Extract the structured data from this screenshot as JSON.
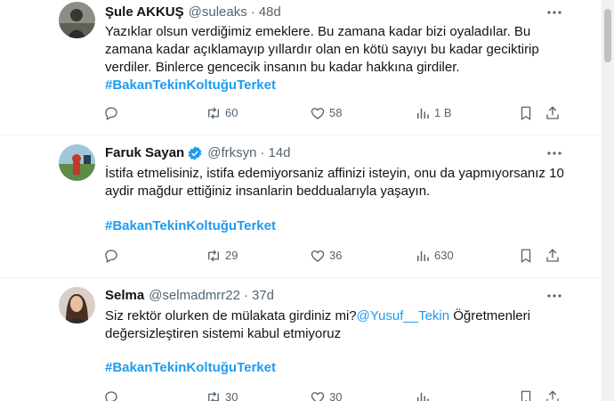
{
  "tweets": [
    {
      "name": "Şule AKKUŞ",
      "handle": "@suleaks",
      "sep": "·",
      "time": "48d",
      "verified": false,
      "text": "Yazıklar olsun verdiğimiz emeklere. Bu zamana kadar bizi oyaladılar. Bu zamana kadar açıklamayıp yıllardır olan en kötü sayıyı bu kadar geciktirip verdiler. Binlerce gencecik insanın bu kadar hakkına girdiler.",
      "hashtag": "#BakanTekinKoltuğuTerket",
      "replies": "",
      "retweets": "60",
      "likes": "58",
      "views": "1 B"
    },
    {
      "name": "Faruk Sayan",
      "handle": "@frksyn",
      "sep": "·",
      "time": "14d",
      "verified": true,
      "text": "İstifa etmelisiniz, istifa edemiyorsaniz affinizi isteyin, onu da yapmıyorsanız 10 aydir mağdur ettiğiniz insanlarin beddualarıyla yaşayın.",
      "hashtag": "#BakanTekinKoltuğuTerket",
      "replies": "",
      "retweets": "29",
      "likes": "36",
      "views": "630"
    },
    {
      "name": "Selma",
      "handle": "@selmadmrr22",
      "sep": "·",
      "time": "37d",
      "verified": false,
      "text_before": "Siz rektör olurken de mülakata girdiniz mi?",
      "mention": "@Yusuf__Tekin",
      "text_after": " Öğretmenleri değersizleştiren  sistemi kabul etmiyoruz",
      "hashtag": "#BakanTekinKoltuğuTerket",
      "replies": "",
      "retweets": "30",
      "likes": "30",
      "views": ""
    }
  ],
  "icons": {
    "reply": "reply-icon",
    "retweet": "retweet-icon",
    "like": "heart-icon",
    "views": "views-icon",
    "bookmark": "bookmark-icon",
    "share": "share-icon",
    "more": "more-icon",
    "verified": "verified-badge-icon"
  },
  "colors": {
    "accent": "#1d9bf0",
    "muted": "#536471",
    "text": "#0f1419",
    "divider": "#eff3f4"
  }
}
